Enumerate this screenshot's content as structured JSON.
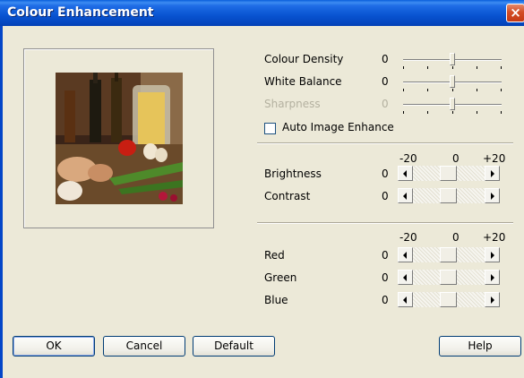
{
  "window": {
    "title": "Colour Enhancement",
    "close_label": "×"
  },
  "enhance": {
    "rows": [
      {
        "label": "Colour Density",
        "value": "0",
        "level": 0.5,
        "enabled": true
      },
      {
        "label": "White Balance",
        "value": "0",
        "level": 0.5,
        "enabled": true
      },
      {
        "label": "Sharpness",
        "value": "0",
        "level": 0.5,
        "enabled": false
      }
    ],
    "auto_label": "Auto Image Enhance",
    "auto_checked": false
  },
  "brightness_group": {
    "scale": {
      "min": "-20",
      "mid": "0",
      "max": "+20"
    },
    "rows": [
      {
        "label": "Brightness",
        "value": "0",
        "level": 0.5
      },
      {
        "label": "Contrast",
        "value": "0",
        "level": 0.5
      }
    ]
  },
  "color_group": {
    "scale": {
      "min": "-20",
      "mid": "0",
      "max": "+20"
    },
    "rows": [
      {
        "label": "Red",
        "value": "0",
        "level": 0.5
      },
      {
        "label": "Green",
        "value": "0",
        "level": 0.5
      },
      {
        "label": "Blue",
        "value": "0",
        "level": 0.5
      }
    ]
  },
  "buttons": {
    "ok": "OK",
    "cancel": "Cancel",
    "default": "Default",
    "help": "Help"
  },
  "colors": {
    "titlebar": "#0a5fdb",
    "dialog_bg": "#ece9d8",
    "close": "#d34d25"
  }
}
